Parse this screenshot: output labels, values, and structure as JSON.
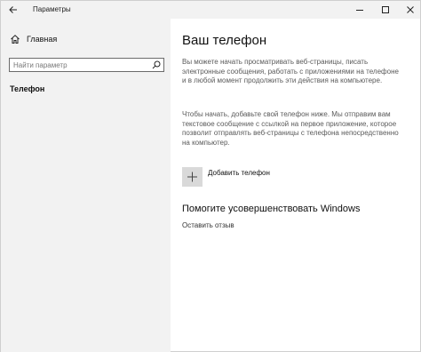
{
  "window": {
    "title": "Параметры",
    "controls": {
      "back": "arrow-left-icon",
      "minimize": "minimize-icon",
      "maximize": "maximize-icon",
      "close": "close-icon"
    }
  },
  "sidebar": {
    "home_label": "Главная",
    "home_icon": "home-icon",
    "search": {
      "placeholder": "Найти параметр",
      "icon": "search-icon"
    },
    "nav_items": [
      {
        "label": "Телефон",
        "selected": true
      }
    ]
  },
  "main": {
    "title": "Ваш телефон",
    "paragraph1": "Вы можете начать просматривать веб-страницы, писать электронные сообщения, работать с приложениями на телефоне и в любой момент продолжить эти действия на компьютере.",
    "paragraph2": "Чтобы начать, добавьте свой телефон ниже. Мы отправим вам текстовое сообщение с ссылкой на первое приложение, которое позволит отправлять веб-страницы с телефона непосредственно на компьютер.",
    "add_phone": {
      "label": "Добавить телефон",
      "icon": "plus-icon"
    },
    "improve": {
      "title": "Помогите усовершенствовать Windows",
      "feedback_link": "Оставить отзыв"
    }
  },
  "colors": {
    "sidebar_bg": "#f2f2f2",
    "main_bg": "#ffffff",
    "body_text": "#5a5a5a",
    "tile_bg": "#d9d9d9"
  }
}
